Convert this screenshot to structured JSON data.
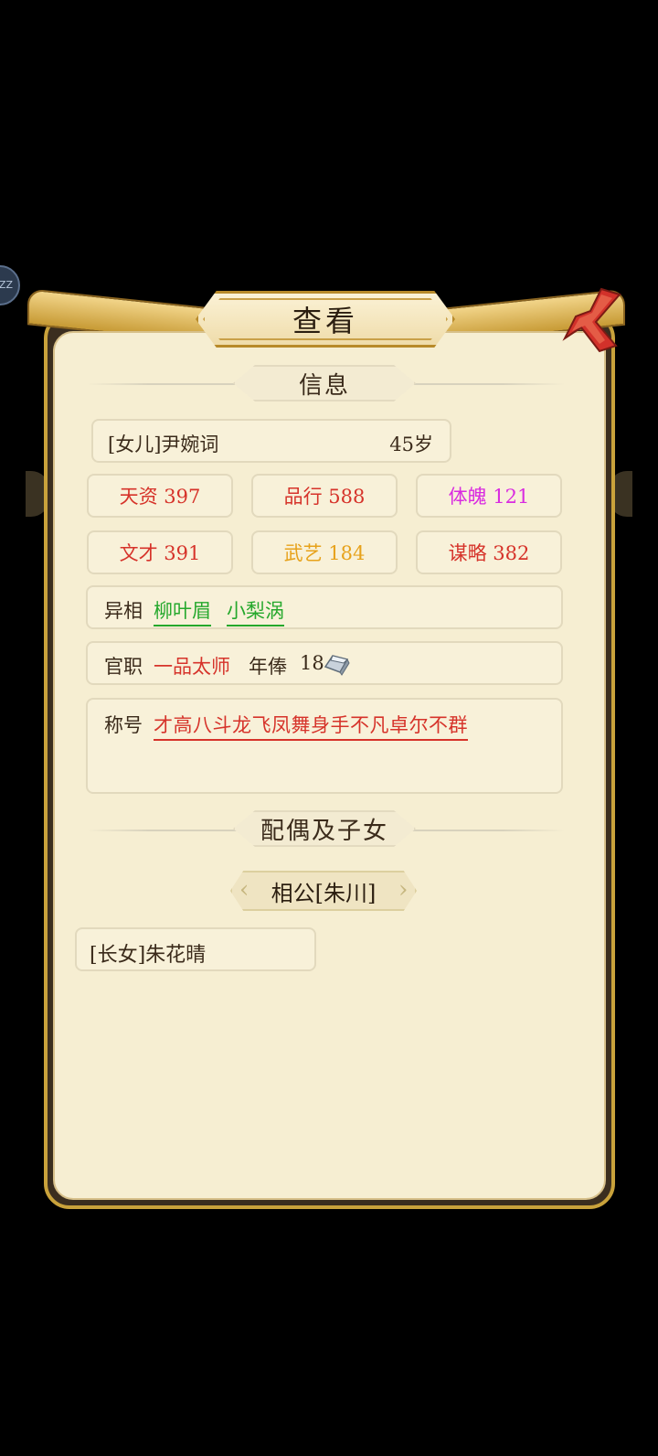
{
  "bubble": {
    "text": "ZZ"
  },
  "dialog": {
    "title": "查看"
  },
  "sections": {
    "info": "信息",
    "family": "配偶及子女"
  },
  "character": {
    "relation_name": "[女儿]尹婉词",
    "age": "45岁"
  },
  "stats": [
    {
      "label": "天资 397",
      "color": "#d6332a"
    },
    {
      "label": "品行 588",
      "color": "#d6332a"
    },
    {
      "label": "体魄 121",
      "color": "#d92be0"
    },
    {
      "label": "文才 391",
      "color": "#d6332a"
    },
    {
      "label": "武艺 184",
      "color": "#e7a21b"
    },
    {
      "label": "谋略 382",
      "color": "#d6332a"
    }
  ],
  "traits": {
    "label": "异相",
    "items": [
      "柳叶眉",
      "小梨涡"
    ]
  },
  "office": {
    "label": "官职",
    "rank": "一品太师",
    "salary_label": "年俸",
    "salary_value": "18",
    "salary_icon": "silver-ingot-icon"
  },
  "titles": {
    "label": "称号",
    "value": "才高八斗龙飞凤舞身手不凡卓尔不群"
  },
  "spouse": {
    "label": "相公[朱川]"
  },
  "children": [
    {
      "label": "[长女]朱花晴"
    }
  ],
  "colors": {
    "frame_gold": "#c9a23b",
    "panel_bg": "#f6eed2",
    "frame_dark": "#3b2e1f"
  }
}
